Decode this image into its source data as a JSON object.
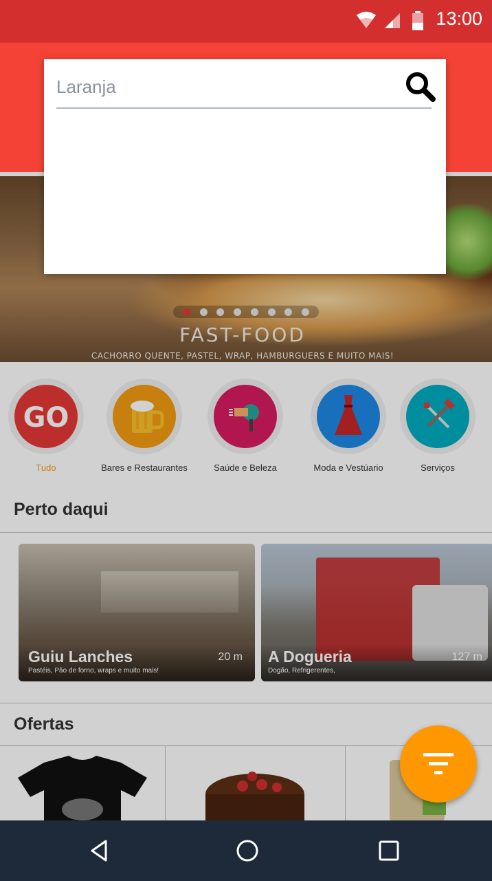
{
  "status_bar": {
    "time": "13:00",
    "icons": [
      "wifi-icon",
      "signal-icon",
      "battery-icon"
    ]
  },
  "search": {
    "value": "Laranja",
    "icon": "search-icon"
  },
  "banner": {
    "title": "FAST-FOOD",
    "subtitle": "CACHORRO QUENTE, PASTEL, WRAP, HAMBURGUERS E MUITO MAIS!",
    "page_count": 8,
    "active_page": 1
  },
  "categories": [
    {
      "label": "Tudo",
      "icon": "go-logo-icon",
      "color": "#e53935",
      "active": true
    },
    {
      "label": "Bares e Restaurantes",
      "icon": "beer-mug-icon",
      "color": "#f39c12",
      "active": false
    },
    {
      "label": "Saúde e Beleza",
      "icon": "hair-dryer-icon",
      "color": "#d81b60",
      "active": false
    },
    {
      "label": "Moda e Vestúario",
      "icon": "dress-icon",
      "color": "#1e88e5",
      "active": false
    },
    {
      "label": "Serviços",
      "icon": "tools-icon",
      "color": "#00acc1",
      "active": false
    }
  ],
  "nearby": {
    "title": "Perto daqui",
    "places": [
      {
        "name": "Guiu Lanches",
        "description": "Pastéis, Pão de forno, wraps e muito mais!",
        "distance": "20 m"
      },
      {
        "name": "A Dogueria",
        "description": "Dogão, Refrigerentes,",
        "distance": "127 m"
      }
    ]
  },
  "offers": {
    "title": "Ofertas",
    "items": [
      "t-shirt-image",
      "cake-image",
      "product-package-image"
    ]
  },
  "fab": {
    "icon": "filter-icon",
    "color": "#ff9800"
  },
  "nav": {
    "buttons": [
      "back-icon",
      "home-icon",
      "recents-icon"
    ]
  },
  "colors": {
    "status_bar": "#d32f2f",
    "app_bar": "#f44336",
    "nav_bar": "#1e2a3a"
  }
}
